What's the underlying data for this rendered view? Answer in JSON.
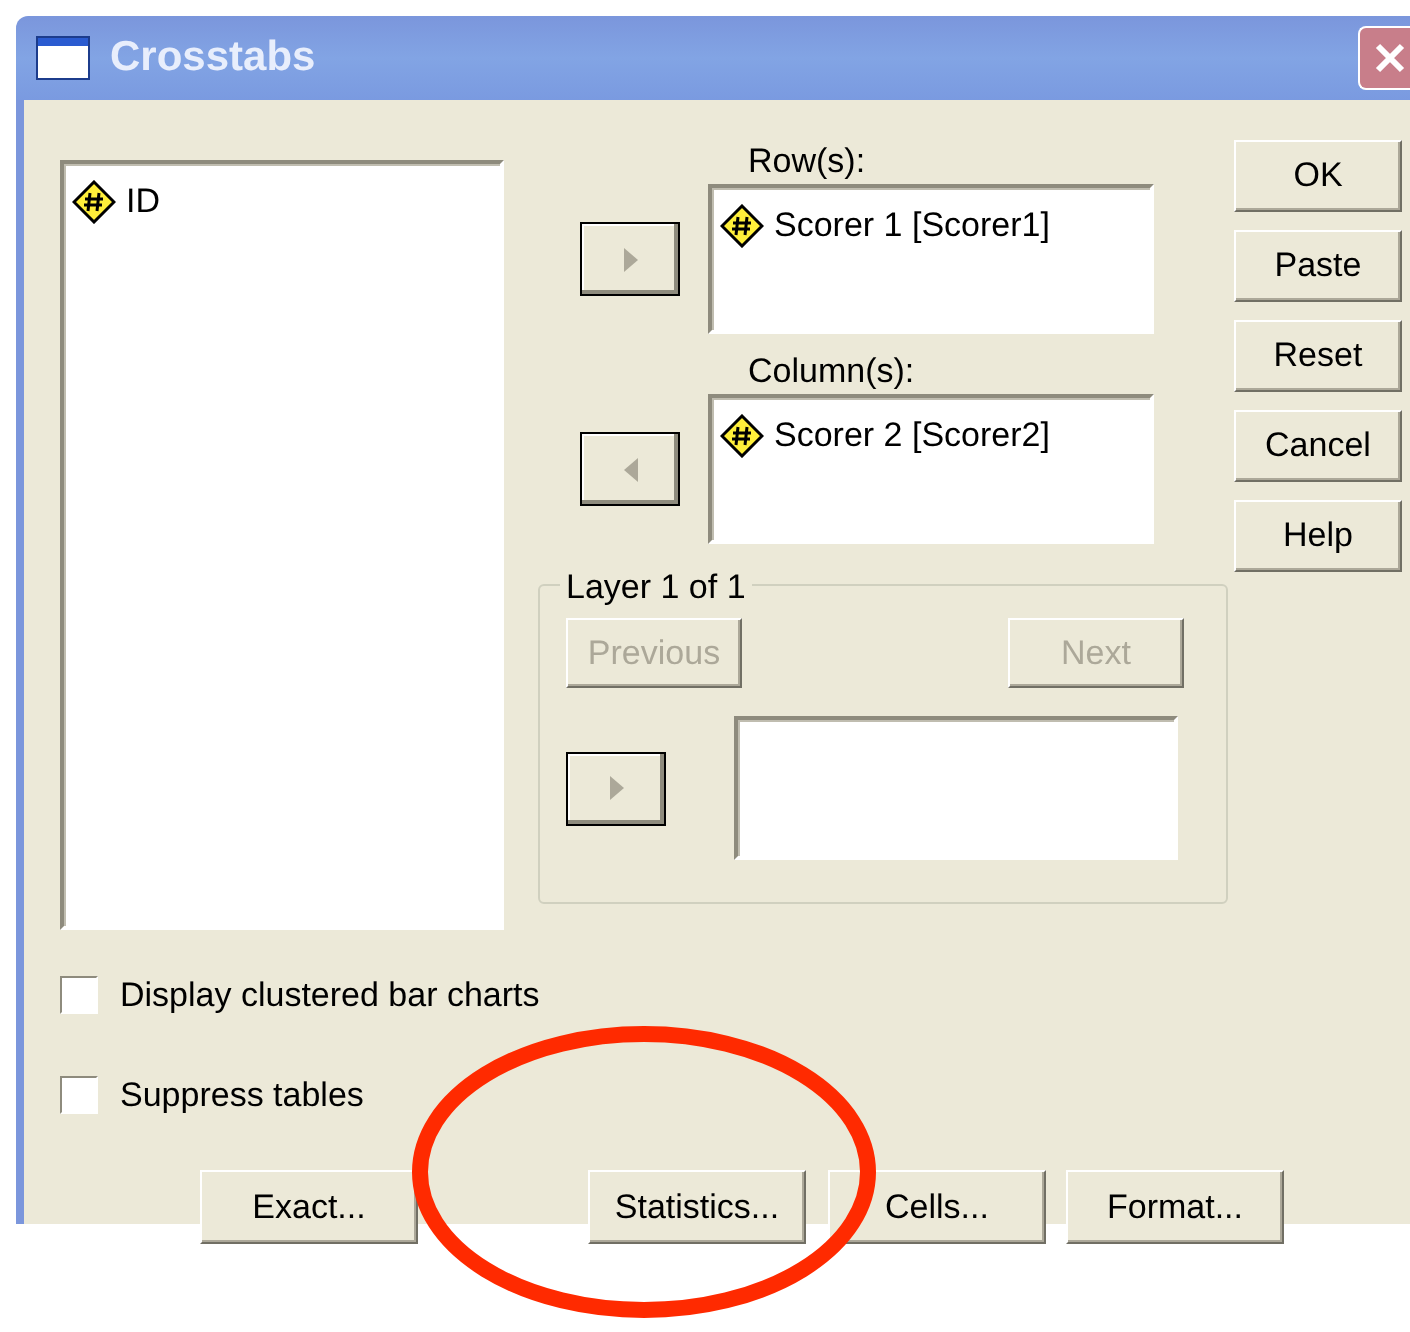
{
  "window": {
    "title": "Crosstabs"
  },
  "source_list": {
    "items": [
      {
        "label": "ID"
      }
    ]
  },
  "rows": {
    "label": "Row(s):",
    "move_button": {
      "kind": "right"
    },
    "items": [
      {
        "label": "Scorer 1 [Scorer1]"
      }
    ]
  },
  "columns": {
    "label": "Column(s):",
    "move_button": {
      "kind": "left"
    },
    "items": [
      {
        "label": "Scorer 2 [Scorer2]"
      }
    ]
  },
  "action_buttons": [
    "OK",
    "Paste",
    "Reset",
    "Cancel",
    "Help"
  ],
  "layer": {
    "title": "Layer 1 of 1",
    "previous": {
      "label": "Previous",
      "disabled": true
    },
    "next": {
      "label": "Next",
      "disabled": true
    },
    "move_button": {
      "kind": "right"
    }
  },
  "options": [
    {
      "label": "Display clustered bar charts",
      "checked": false
    },
    {
      "label": "Suppress tables",
      "checked": false
    }
  ],
  "bottom_buttons": [
    "Exact...",
    "Statistics...",
    "Cells...",
    "Format..."
  ]
}
